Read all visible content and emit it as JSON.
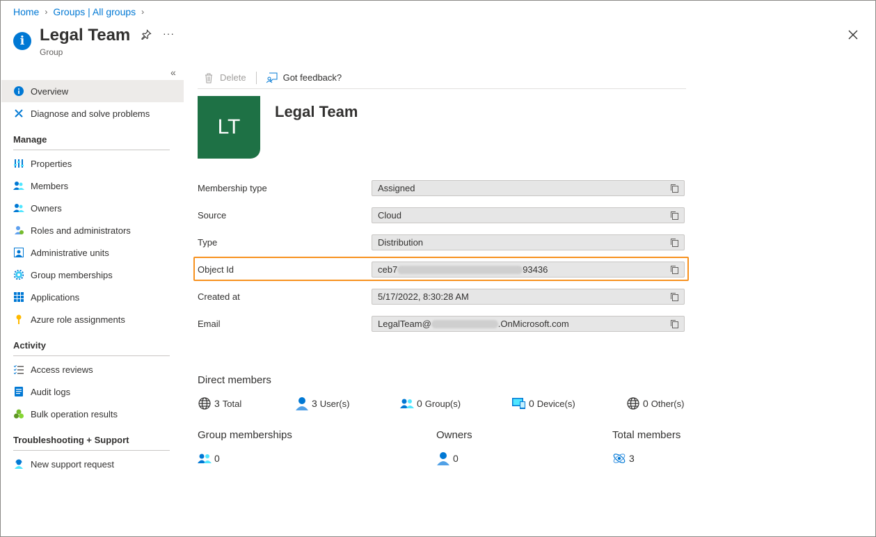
{
  "breadcrumb": {
    "home": "Home",
    "groups": "Groups | All groups"
  },
  "header": {
    "title": "Legal Team",
    "subtitle": "Group",
    "more": "···"
  },
  "nav": {
    "collapse": "«",
    "overview": "Overview",
    "diagnose": "Diagnose and solve problems",
    "manage_title": "Manage",
    "properties": "Properties",
    "members": "Members",
    "owners": "Owners",
    "roles": "Roles and administrators",
    "admin_units": "Administrative units",
    "group_memberships": "Group memberships",
    "applications": "Applications",
    "azure_roles": "Azure role assignments",
    "activity_title": "Activity",
    "access_reviews": "Access reviews",
    "audit_logs": "Audit logs",
    "bulk_ops": "Bulk operation results",
    "troubleshoot_title": "Troubleshooting + Support",
    "support_request": "New support request"
  },
  "toolbar": {
    "delete": "Delete",
    "feedback": "Got feedback?"
  },
  "entity": {
    "initials": "LT",
    "name": "Legal Team"
  },
  "properties": {
    "membership_type_label": "Membership type",
    "membership_type": "Assigned",
    "source_label": "Source",
    "source": "Cloud",
    "type_label": "Type",
    "type": "Distribution",
    "object_id_label": "Object Id",
    "object_id_prefix": "ceb7",
    "object_id_suffix": "93436",
    "created_label": "Created at",
    "created": "5/17/2022, 8:30:28 AM",
    "email_label": "Email",
    "email_prefix": "LegalTeam@",
    "email_suffix": ".OnMicrosoft.com"
  },
  "direct_members": {
    "title": "Direct members",
    "total": "3",
    "total_label": "Total",
    "users": "3",
    "users_label": "User(s)",
    "groups": "0",
    "groups_label": "Group(s)",
    "devices": "0",
    "devices_label": "Device(s)",
    "others": "0",
    "others_label": "Other(s)"
  },
  "summary": {
    "group_memberships_title": "Group memberships",
    "group_memberships": "0",
    "owners_title": "Owners",
    "owners": "0",
    "total_members_title": "Total members",
    "total_members": "3"
  },
  "colors": {
    "accent": "#0078d4",
    "avatar": "#1e7145",
    "highlight": "#f7911e"
  }
}
